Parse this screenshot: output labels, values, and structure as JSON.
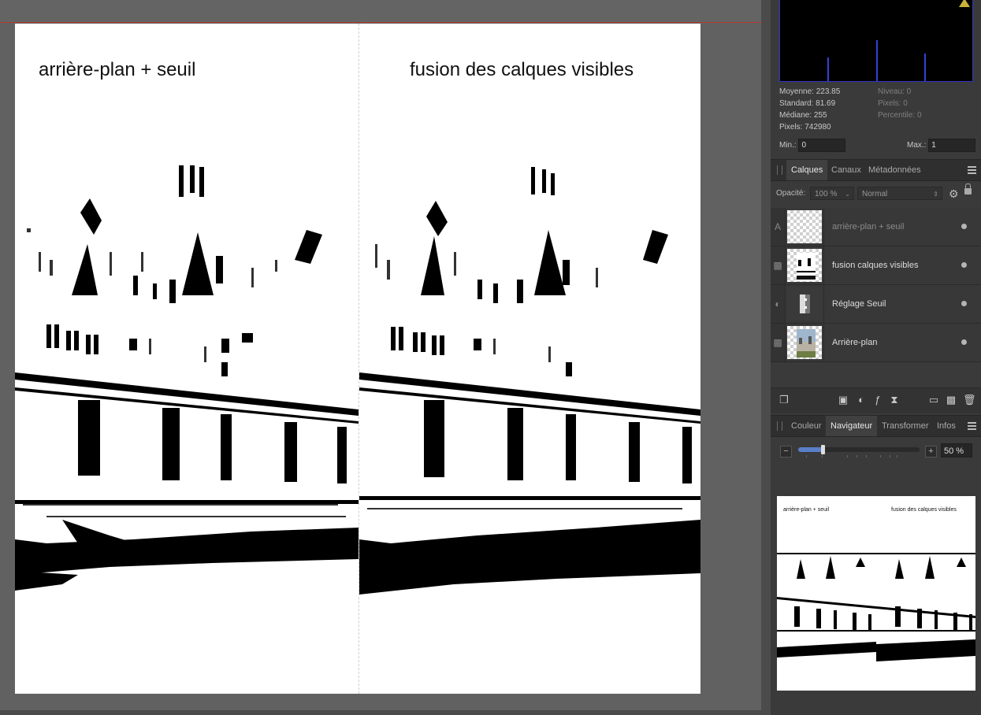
{
  "document": {
    "left_title": "arrière-plan + seuil",
    "right_title": "fusion des calques visibles"
  },
  "histogram": {
    "warning_icon": "warning-icon",
    "stats_left": [
      "Moyenne: 223.85",
      "Standard: 81.69",
      "Médiane: 255",
      "Pixels: 742980"
    ],
    "stats_right": [
      "Niveau: 0",
      "Pixels: 0",
      "Percentile: 0"
    ],
    "min_label": "Min.:",
    "min_value": "0",
    "max_label": "Max.:",
    "max_value": "1"
  },
  "layers_panel": {
    "tabs": [
      "Calques",
      "Canaux",
      "Métadonnées"
    ],
    "active_tab": "Calques",
    "opacity_label": "Opacité:",
    "opacity_value": "100 %",
    "blend_mode": "Normal",
    "layers": [
      {
        "name": "arrière-plan + seuil",
        "kind": "A",
        "dimmed": true
      },
      {
        "name": "fusion calques visibles",
        "kind": "pixel"
      },
      {
        "name": "Réglage Seuil",
        "kind": "adjustment"
      },
      {
        "name": "Arrière-plan",
        "kind": "pixel"
      }
    ]
  },
  "navigator_panel": {
    "tabs": [
      "Couleur",
      "Navigateur",
      "Transformer",
      "Infos"
    ],
    "active_tab": "Navigateur",
    "zoom_value": "50 %",
    "zoom_fraction": 0.2,
    "minus_label": "−",
    "plus_label": "+",
    "preview_left_title": "arrière-plan + seuil",
    "preview_right_title": "fusion des calques visibles"
  },
  "colors": {
    "canvas_bg": "#616161",
    "panel_bg": "#3a3a3a",
    "histogram_bar": "#3540d8",
    "slider_fill": "#5a7fc8",
    "active_tab": "#404040"
  }
}
